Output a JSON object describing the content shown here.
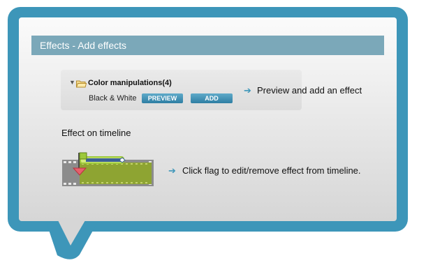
{
  "header": {
    "title": "Effects - Add effects"
  },
  "effects_tree": {
    "category_label": "Color manipulations(4)",
    "effect_name": "Black & White",
    "preview_label": "PREVIEW",
    "add_label": "ADD"
  },
  "hints": {
    "arrow_glyph": "➔",
    "preview_add": "Preview and add an effect",
    "flag_edit": "Click flag to edit/remove effect from timeline."
  },
  "timeline": {
    "title": "Effect on timeline"
  },
  "colors": {
    "frame": "#3d96b9",
    "header": "#7ba8b9",
    "button": "#2e7ea3",
    "clip": "#8ea432",
    "flag": "#9cc83a",
    "marker": "#e5606c"
  }
}
